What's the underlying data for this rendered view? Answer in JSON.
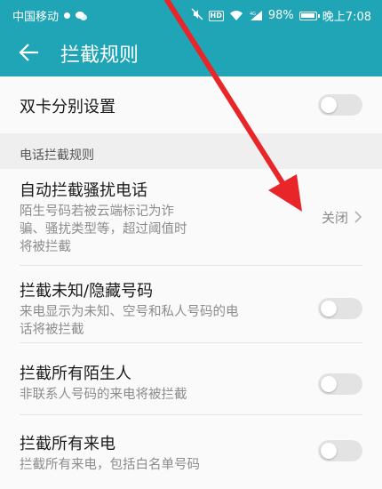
{
  "status_bar": {
    "carrier": "中国移动",
    "battery_percent": "98%",
    "time": "晚上7:08",
    "icons": [
      "notification-dot",
      "chat-icon",
      "mute-icon",
      "hd-badge",
      "wifi-icon",
      "signal-icon",
      "battery-icon"
    ],
    "hd_label": "HD",
    "signal_label": "4G"
  },
  "app_bar": {
    "title": "拦截规则",
    "back_icon": "arrow-left-icon"
  },
  "rows": {
    "dual_sim": {
      "title": "双卡分别设置",
      "toggle_on": false
    },
    "section_call": {
      "title": "电话拦截规则"
    },
    "auto_block": {
      "title": "自动拦截骚扰电话",
      "sub_line1": "陌生号码若被云端标记为诈",
      "sub_line2": "骗、骚扰类型等，超过阈值时",
      "sub_line3": "将被拦截",
      "value": "关闭"
    },
    "unknown": {
      "title": "拦截未知/隐藏号码",
      "sub_line1": "来电显示为未知、空号和私人号码的电",
      "sub_line2": "话将被拦截",
      "toggle_on": false
    },
    "strangers": {
      "title": "拦截所有陌生人",
      "sub_line1": "非联系人号码的来电将被拦截",
      "toggle_on": false
    },
    "all_calls": {
      "title": "拦截所有来电",
      "sub_line1": "拦截所有来电，包括白名单号码",
      "toggle_on": false
    }
  },
  "colors": {
    "accent": "#1fa5b6",
    "annotation_arrow": "#e8262a",
    "toggle_off": "#e3e3e3"
  }
}
